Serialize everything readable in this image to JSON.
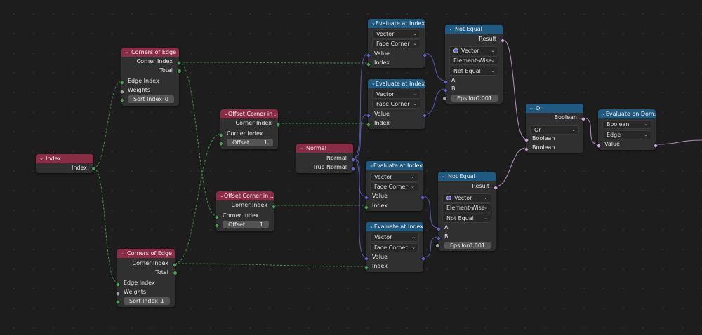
{
  "colors": {
    "canvas_bg": "#1d1d1d",
    "node_body": "#303030",
    "header_red": "#8b2c47",
    "header_blue": "#1f5a80",
    "socket_int": "#4e9c57",
    "socket_vector": "#6363c7",
    "socket_bool": "#cca6d6",
    "socket_float": "#a1a1a1"
  },
  "nodes": {
    "index": {
      "title": "Index",
      "out": "Index"
    },
    "coe1": {
      "title": "Corners of Edge",
      "out1": "Corner Index",
      "out2": "Total",
      "in1": "Edge Index",
      "in2": "Weights",
      "field_label": "Sort Index",
      "field_value": "0"
    },
    "coe2": {
      "title": "Corners of Edge",
      "out1": "Corner Index",
      "out2": "Total",
      "in1": "Edge Index",
      "in2": "Weights",
      "field_label": "Sort Index",
      "field_value": "1"
    },
    "oc1": {
      "title": "Offset Corner in ...",
      "out": "Corner Index",
      "in": "Corner Index",
      "field_label": "Offset",
      "field_value": "1"
    },
    "oc2": {
      "title": "Offset Corner in ...",
      "out": "Corner Index",
      "in": "Corner Index",
      "field_label": "Offset",
      "field_value": "1"
    },
    "normal": {
      "title": "Normal",
      "out1": "Normal",
      "out2": "True Normal"
    },
    "ev1": {
      "title": "Evaluate at Index",
      "sel1": "Vector",
      "sel2": "Face Corner",
      "in1": "Value",
      "in2": "Index"
    },
    "ev2": {
      "title": "Evaluate at Index",
      "sel1": "Vector",
      "sel2": "Face Corner",
      "in1": "Value",
      "in2": "Index"
    },
    "ev3": {
      "title": "Evaluate at Index",
      "sel1": "Vector",
      "sel2": "Face Corner",
      "in1": "Value",
      "in2": "Index"
    },
    "ev4": {
      "title": "Evaluate at Index",
      "sel1": "Vector",
      "sel2": "Face Corner",
      "in1": "Value",
      "in2": "Index"
    },
    "ne1": {
      "title": "Not Equal",
      "out": "Result",
      "sel1": "Vector",
      "sel2": "Element-Wise",
      "sel3": "Not Equal",
      "in1": "A",
      "in2": "B",
      "field_label": "Epsilon",
      "field_value": "0.001"
    },
    "ne2": {
      "title": "Not Equal",
      "out": "Result",
      "sel1": "Vector",
      "sel2": "Element-Wise",
      "sel3": "Not Equal",
      "in1": "A",
      "in2": "B",
      "field_label": "Epsilon",
      "field_value": "0.001"
    },
    "or": {
      "title": "Or",
      "out": "Boolean",
      "sel": "Or",
      "in1": "Boolean",
      "in2": "Boolean"
    },
    "eod": {
      "title": "Evaluate on Dom...",
      "sel1": "Boolean",
      "sel2": "Edge",
      "in": "Value"
    }
  }
}
